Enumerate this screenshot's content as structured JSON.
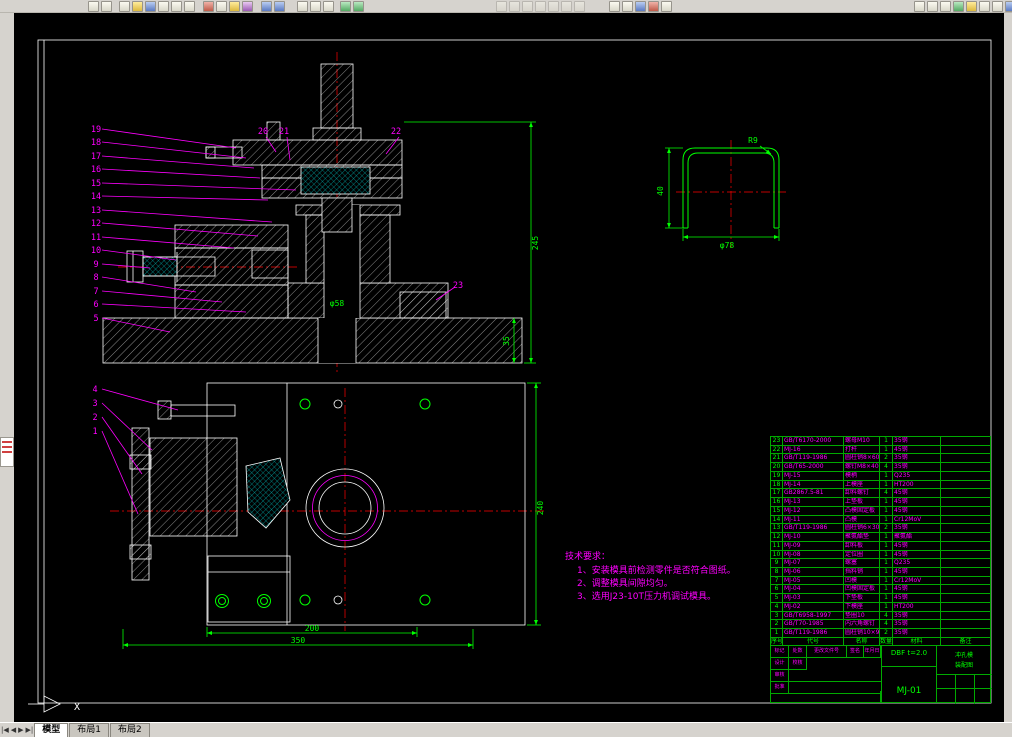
{
  "toolbar": {
    "icons": [
      "pointer-icon",
      "quick-select-icon",
      "new-file-icon",
      "open-icon",
      "save-icon",
      "print-icon",
      "print-preview-icon",
      "search-icon",
      "cut-icon",
      "copy-icon",
      "paste-icon",
      "format-painter-icon",
      "undo-icon",
      "redo-icon",
      "pan-icon",
      "zoom-realtime-icon",
      "zoom-window-icon",
      "layers-icon",
      "layer-properties-icon",
      "draw-line-icon",
      "draw-circle-icon",
      "draw-arc-icon",
      "draw-polyline-icon",
      "draw-rect-icon",
      "draw-hatch-icon",
      "draw-text-icon",
      "dim-linear-icon",
      "dim-radius-icon",
      "properties-icon",
      "color-icon",
      "linetype-icon",
      "zoom-in-icon",
      "zoom-out-icon",
      "zoom-extents-icon",
      "regen-icon",
      "help-icon",
      "settings-icon",
      "about-icon",
      "grid-icon"
    ]
  },
  "statusbar": {
    "nav": [
      "|◀",
      "◀",
      "▶",
      "▶|"
    ],
    "tabs": [
      "模型",
      "布局1",
      "布局2"
    ],
    "active_tab": "模型"
  },
  "drawing": {
    "items": [
      "1",
      "2",
      "3",
      "4",
      "5",
      "6",
      "7",
      "8",
      "9",
      "10",
      "11",
      "12",
      "13",
      "14",
      "15",
      "16",
      "17",
      "18",
      "19",
      "20",
      "21",
      "22",
      "23"
    ],
    "dims": {
      "overall_height": "245",
      "base_thickness": "35",
      "hole_dia": "φ58",
      "plan_width": "200",
      "plan_total": "350",
      "plan_side": "240",
      "cup_radius": "R9",
      "cup_height": "40",
      "cup_dia": "φ78"
    },
    "tech_req": {
      "title": "技术要求：",
      "lines": [
        "1、安装模具前检测零件是否符合图纸。",
        "2、调整模具间隙均匀。",
        "3、选用J23-10T压力机调试模具。"
      ]
    },
    "ucs_x_label": "X"
  },
  "bom": {
    "headers": [
      "序号",
      "代号",
      "名称",
      "数量",
      "材料",
      "备注"
    ],
    "rows": [
      {
        "no": "23",
        "code": "GB/T6170-2000",
        "name": "螺母M10",
        "qty": "1",
        "mat": "35钢",
        "rem": ""
      },
      {
        "no": "22",
        "code": "MJ-16",
        "name": "打杆",
        "qty": "1",
        "mat": "45钢",
        "rem": ""
      },
      {
        "no": "21",
        "code": "GB/T119-1986",
        "name": "圆柱销8×60",
        "qty": "2",
        "mat": "35钢",
        "rem": ""
      },
      {
        "no": "20",
        "code": "GB/T65-2000",
        "name": "螺钉M8×40",
        "qty": "4",
        "mat": "35钢",
        "rem": ""
      },
      {
        "no": "19",
        "code": "MJ-15",
        "name": "模柄",
        "qty": "1",
        "mat": "Q235",
        "rem": ""
      },
      {
        "no": "18",
        "code": "MJ-14",
        "name": "上模座",
        "qty": "1",
        "mat": "HT200",
        "rem": ""
      },
      {
        "no": "17",
        "code": "GB2867.5-81",
        "name": "卸料螺钉",
        "qty": "4",
        "mat": "45钢",
        "rem": ""
      },
      {
        "no": "16",
        "code": "MJ-13",
        "name": "上垫板",
        "qty": "1",
        "mat": "45钢",
        "rem": ""
      },
      {
        "no": "15",
        "code": "MJ-12",
        "name": "凸模固定板",
        "qty": "1",
        "mat": "45钢",
        "rem": ""
      },
      {
        "no": "14",
        "code": "MJ-11",
        "name": "凸模",
        "qty": "1",
        "mat": "Cr12MoV",
        "rem": ""
      },
      {
        "no": "13",
        "code": "GB/T119-1986",
        "name": "圆柱销6×30",
        "qty": "2",
        "mat": "35钢",
        "rem": ""
      },
      {
        "no": "12",
        "code": "MJ-10",
        "name": "聚氨酯垫",
        "qty": "1",
        "mat": "聚氨酯",
        "rem": ""
      },
      {
        "no": "11",
        "code": "MJ-09",
        "name": "卸料板",
        "qty": "1",
        "mat": "45钢",
        "rem": ""
      },
      {
        "no": "10",
        "code": "MJ-08",
        "name": "定位圈",
        "qty": "1",
        "mat": "45钢",
        "rem": ""
      },
      {
        "no": "9",
        "code": "MJ-07",
        "name": "螺塞",
        "qty": "1",
        "mat": "Q235",
        "rem": ""
      },
      {
        "no": "8",
        "code": "MJ-06",
        "name": "挡料销",
        "qty": "1",
        "mat": "45钢",
        "rem": ""
      },
      {
        "no": "7",
        "code": "MJ-05",
        "name": "凹模",
        "qty": "1",
        "mat": "Cr12MoV",
        "rem": ""
      },
      {
        "no": "6",
        "code": "MJ-04",
        "name": "凹模固定板",
        "qty": "1",
        "mat": "45钢",
        "rem": ""
      },
      {
        "no": "5",
        "code": "MJ-03",
        "name": "下垫板",
        "qty": "1",
        "mat": "45钢",
        "rem": ""
      },
      {
        "no": "4",
        "code": "MJ-02",
        "name": "下模座",
        "qty": "1",
        "mat": "HT200",
        "rem": ""
      },
      {
        "no": "3",
        "code": "GB/T6958-1997",
        "name": "垫圈10",
        "qty": "4",
        "mat": "35钢",
        "rem": ""
      },
      {
        "no": "2",
        "code": "GB/T70-1985",
        "name": "内六角螺钉",
        "qty": "4",
        "mat": "35钢",
        "rem": ""
      },
      {
        "no": "1",
        "code": "GB/T119-1986",
        "name": "圆柱销10×90",
        "qty": "2",
        "mat": "35钢",
        "rem": ""
      }
    ]
  },
  "titleblock": {
    "material_spec": "DBF t=2.0",
    "drawing_no": "MJ-01",
    "title_lines": [
      "冲孔模",
      "装配图"
    ],
    "labels": [
      "标记",
      "处数",
      "更改文件号",
      "签名",
      "年月日",
      "设计",
      "校核",
      "审核",
      "批准"
    ]
  }
}
